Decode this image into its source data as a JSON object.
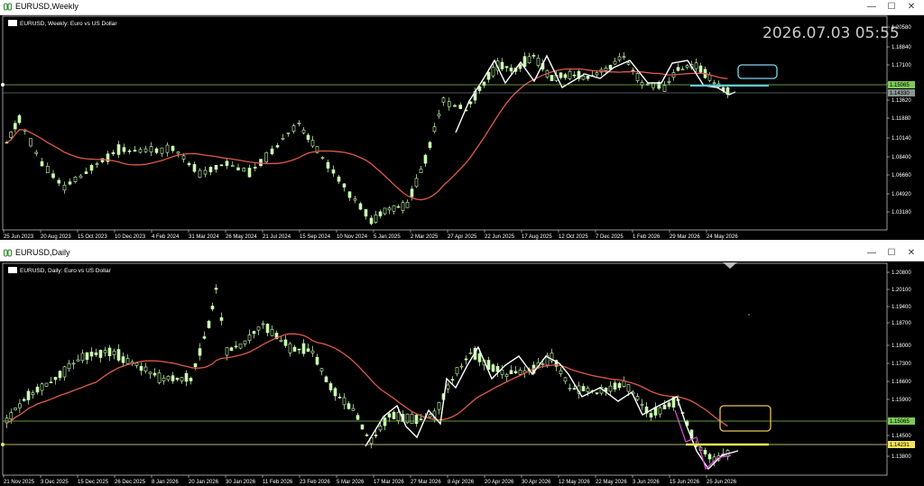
{
  "colors": {
    "background": "#000000",
    "bull": "#ccffb3",
    "grid": "#ffffff",
    "ma": "#e05a4a",
    "zigzag": "#ffffff",
    "hline_green": "#7fc85a",
    "hline_yellow": "#f2e35b",
    "box_cyan": "#7fd3f0",
    "box_yellow": "#e8c45c",
    "hline_cyan": "#63c8f0",
    "magenta": "#d94fd9"
  },
  "weekly": {
    "window_title": "EURUSD,Weekly",
    "symbol_label": "EURUSD, Weekly:  Euro vs US Dollar",
    "clock": "2026.07.03 05:55",
    "price_axis": [
      "1.20580",
      "1.18840",
      "1.17100",
      "1.15360",
      "1.13620",
      "1.11880",
      "1.10140",
      "1.08400",
      "1.06660",
      "1.04920",
      "1.03180"
    ],
    "price_marker_green": "1.15065",
    "price_marker_gray": "1.14330",
    "time_axis": [
      "25 Jun 2023",
      "20 Aug 2023",
      "15 Oct 2023",
      "10 Dec 2023",
      "4 Feb 2024",
      "31 Mar 2024",
      "26 May 2024",
      "21 Jul 2024",
      "15 Sep 2024",
      "10 Nov 2024",
      "5 Jan 2025",
      "2 Mar 2025",
      "27 Apr 2025",
      "22 Jun 2025",
      "17 Aug 2025",
      "12 Oct 2025",
      "7 Dec 2025",
      "1 Feb 2026",
      "29 Mar 2026",
      "24 May 2026"
    ]
  },
  "daily": {
    "window_title": "EURUSD,Daily",
    "symbol_label": "EURUSD, Daily:  Euro vs US Dollar",
    "price_axis": [
      "1.20800",
      "1.20100",
      "1.19400",
      "1.18700",
      "1.18000",
      "1.17300",
      "1.16600",
      "1.15900",
      "1.14500",
      "1.13800"
    ],
    "price_marker_green": "1.15065",
    "price_marker_yellow": "1.14231",
    "time_axis": [
      "21 Nov 2025",
      "3 Dec 2025",
      "15 Dec 2025",
      "26 Dec 2025",
      "8 Jan 2026",
      "20 Jan 2026",
      "30 Jan 2026",
      "11 Feb 2026",
      "23 Feb 2026",
      "5 Mar 2026",
      "17 Mar 2026",
      "27 Mar 2026",
      "8 Apr 2026",
      "20 Apr 2026",
      "30 Apr 2026",
      "12 May 2026",
      "22 May 2026",
      "3 Jun 2026",
      "15 Jun 2026",
      "25 Jun 2026"
    ]
  },
  "window_buttons": {
    "minimize": "—",
    "maximize": "☐",
    "close": "✕"
  }
}
